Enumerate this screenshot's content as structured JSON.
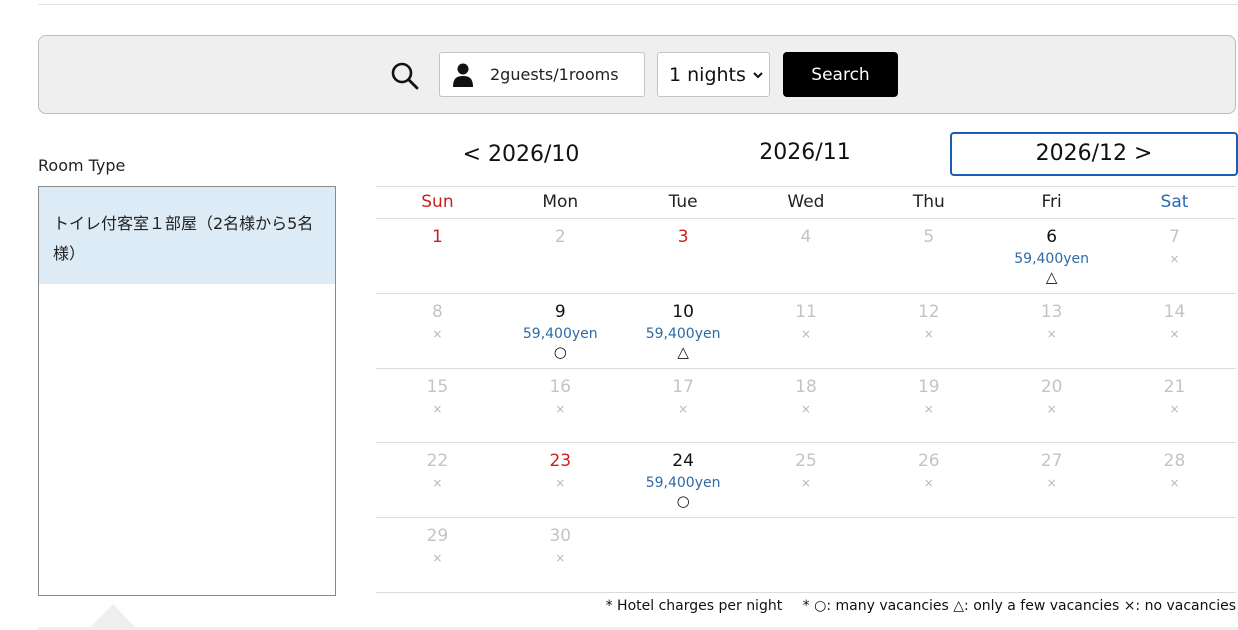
{
  "search": {
    "guests_label": "2guests/1rooms",
    "nights_label": "1 nights",
    "search_label": "Search"
  },
  "sidebar": {
    "heading": "Room Type",
    "items": [
      {
        "label": "トイレ付客室１部屋（2名様から5名様）"
      }
    ]
  },
  "month_nav": {
    "prev_label": "< 2026/10",
    "current_label": "2026/11",
    "next_label": "2026/12 >"
  },
  "calendar": {
    "weekdays": [
      "Sun",
      "Mon",
      "Tue",
      "Wed",
      "Thu",
      "Fri",
      "Sat"
    ],
    "weeks": [
      [
        {
          "day": "1",
          "status": "holiday"
        },
        {
          "day": "2",
          "status": "none"
        },
        {
          "day": "3",
          "status": "holiday"
        },
        {
          "day": "4",
          "status": "none"
        },
        {
          "day": "5",
          "status": "none"
        },
        {
          "day": "6",
          "status": "few",
          "price": "59,400yen",
          "mark": "△"
        },
        {
          "day": "7",
          "status": "none",
          "mark": "×"
        }
      ],
      [
        {
          "day": "8",
          "status": "none",
          "mark": "×"
        },
        {
          "day": "9",
          "status": "many",
          "price": "59,400yen",
          "mark": "○"
        },
        {
          "day": "10",
          "status": "few",
          "price": "59,400yen",
          "mark": "△"
        },
        {
          "day": "11",
          "status": "none",
          "mark": "×"
        },
        {
          "day": "12",
          "status": "none",
          "mark": "×"
        },
        {
          "day": "13",
          "status": "none",
          "mark": "×"
        },
        {
          "day": "14",
          "status": "none",
          "mark": "×"
        }
      ],
      [
        {
          "day": "15",
          "status": "none",
          "mark": "×"
        },
        {
          "day": "16",
          "status": "none",
          "mark": "×"
        },
        {
          "day": "17",
          "status": "none",
          "mark": "×"
        },
        {
          "day": "18",
          "status": "none",
          "mark": "×"
        },
        {
          "day": "19",
          "status": "none",
          "mark": "×"
        },
        {
          "day": "20",
          "status": "none",
          "mark": "×"
        },
        {
          "day": "21",
          "status": "none",
          "mark": "×"
        }
      ],
      [
        {
          "day": "22",
          "status": "none",
          "mark": "×"
        },
        {
          "day": "23",
          "status": "holiday",
          "mark": "×"
        },
        {
          "day": "24",
          "status": "many",
          "price": "59,400yen",
          "mark": "○"
        },
        {
          "day": "25",
          "status": "none",
          "mark": "×"
        },
        {
          "day": "26",
          "status": "none",
          "mark": "×"
        },
        {
          "day": "27",
          "status": "none",
          "mark": "×"
        },
        {
          "day": "28",
          "status": "none",
          "mark": "×"
        }
      ],
      [
        {
          "day": "29",
          "status": "none",
          "mark": "×"
        },
        {
          "day": "30",
          "status": "none",
          "mark": "×"
        },
        {
          "day": "",
          "status": "empty"
        },
        {
          "day": "",
          "status": "empty"
        },
        {
          "day": "",
          "status": "empty"
        },
        {
          "day": "",
          "status": "empty"
        },
        {
          "day": "",
          "status": "empty"
        }
      ]
    ]
  },
  "legend": {
    "charges_note": "* Hotel charges per night",
    "marks_note": "* ○: many vacancies △: only a few vacancies ×: no vacancies"
  },
  "colors": {
    "holiday": "#cc1f1f",
    "saturday": "#2a68b8",
    "price": "#2e6aa4",
    "unavailable": "#c4c4c4",
    "selected_room_bg": "#ddebf6",
    "active_border": "#1a5bb8"
  },
  "icons": {
    "search": "search-icon",
    "guests": "person-icon",
    "dropdown": "chevron-down-icon"
  }
}
